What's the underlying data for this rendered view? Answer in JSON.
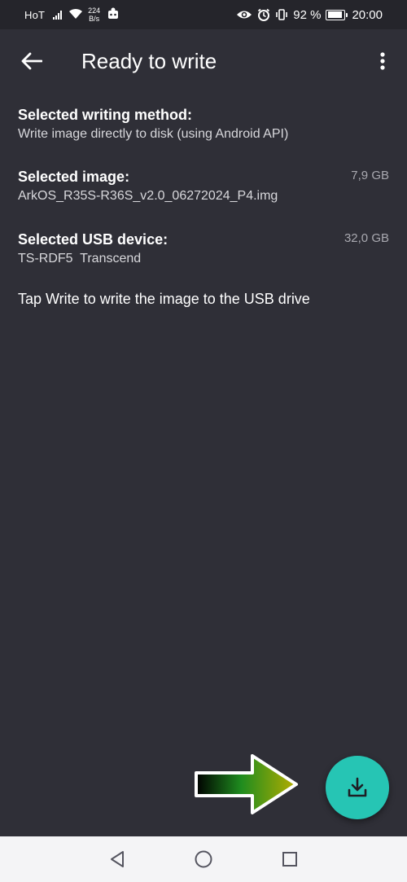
{
  "status_bar": {
    "carrier": "HoT",
    "speed_value": "224",
    "speed_unit": "B/s",
    "battery_percent": "92 %",
    "time": "20:00",
    "icons": [
      "signal-icon",
      "wifi-icon",
      "notification-icon",
      "eye-icon",
      "alarm-icon",
      "vibrate-icon",
      "battery-icon"
    ]
  },
  "app_bar": {
    "title": "Ready to write",
    "back_icon": "arrow-back-icon",
    "menu_icon": "more-vert-icon"
  },
  "sections": {
    "method": {
      "label": "Selected writing method:",
      "value": "Write image directly to disk (using Android API)"
    },
    "image": {
      "label": "Selected image:",
      "value": "ArkOS_R35S-R36S_v2.0_06272024_P4.img",
      "size": "7,9 GB"
    },
    "usb": {
      "label": "Selected USB device:",
      "value": "TS-RDF5  Transcend",
      "size": "32,0 GB"
    }
  },
  "hint": "Tap Write to write the image to the USB drive",
  "fab": {
    "icon": "download-icon",
    "color": "#26c5b4"
  },
  "annotation": {
    "icon": "pointer-arrow-icon"
  },
  "nav_bar": {
    "icons": [
      "back-triangle-icon",
      "home-circle-icon",
      "recents-square-icon"
    ]
  },
  "colors": {
    "background": "#2f2f37",
    "status_bar": "#25252b",
    "nav_bar": "#f4f4f6",
    "accent": "#26c5b4"
  }
}
